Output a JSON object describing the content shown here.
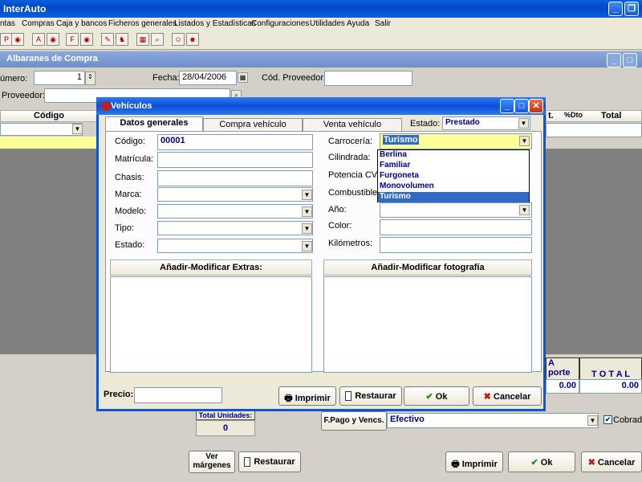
{
  "app": {
    "title": "InterAuto"
  },
  "menu": [
    "ntas",
    "Compras",
    "Caja y bancos",
    "Ficheros generales",
    "Listados y Estadísticas",
    "Configuraciones",
    "Utilidades",
    "Ayuda",
    "Salir"
  ],
  "window": {
    "title": "Albaranes de Compra",
    "numero_label": "úmero:",
    "numero_value": "1",
    "fecha_label": "Fecha:",
    "fecha_value": "28/04/2006",
    "cod_proveedor_label": "Cód. Proveedor:",
    "proveedor_label": "Proveedor:",
    "grid_codigo": "Código",
    "grid_t": "t.",
    "grid_dto": "%Dto",
    "grid_total": "Total",
    "a_label": "A",
    "porte_label": "porte",
    "total_label": "T O T A L",
    "importe_value": "0.00",
    "total_value": "0.00",
    "total_unidades_label": "Total Unidades:",
    "total_unidades_value": "0",
    "fpago_button": "F.Pago y Vencs.",
    "fpago_value": "Efectivo",
    "cobrado_label": "Cobrado",
    "ver_margenes": "Ver\nmárgenes",
    "restaurar": "Restaurar",
    "imprimir": "Imprimir",
    "ok": "Ok",
    "cancelar": "Cancelar"
  },
  "dialog": {
    "title": "Vehículos",
    "tabs": [
      "Datos generales",
      "Compra vehículo",
      "Venta vehículo"
    ],
    "estado_label": "Estado:",
    "estado_value": "Prestado",
    "left_fields": {
      "codigo_label": "Código:",
      "codigo_value": "00001",
      "matricula_label": "Matrícula:",
      "chasis_label": "Chasis:",
      "marca_label": "Marca:",
      "modelo_label": "Modelo:",
      "tipo_label": "Tipo:",
      "estado_label": "Estado:"
    },
    "right_fields": {
      "carroceria_label": "Carrocería:",
      "carroceria_value": "Turismo",
      "cilindrada_label": "Cilindrada:",
      "potencia_label": "Potencia CV:",
      "combustible_label": "Combustible:",
      "ano_label": "Año:",
      "color_label": "Color:",
      "kilometros_label": "Kilómetros:"
    },
    "carroceria_options": [
      "Berlina",
      "Familiar",
      "Furgoneta",
      "Monovolumen",
      "Turismo"
    ],
    "extras_label": "Añadir-Modificar Extras:",
    "foto_label": "Añadir-Modificar fotografía",
    "precio_label": "Precio:",
    "imprimir": "Imprimir",
    "restaurar": "Restaurar",
    "ok": "Ok",
    "cancelar": "Cancelar"
  }
}
